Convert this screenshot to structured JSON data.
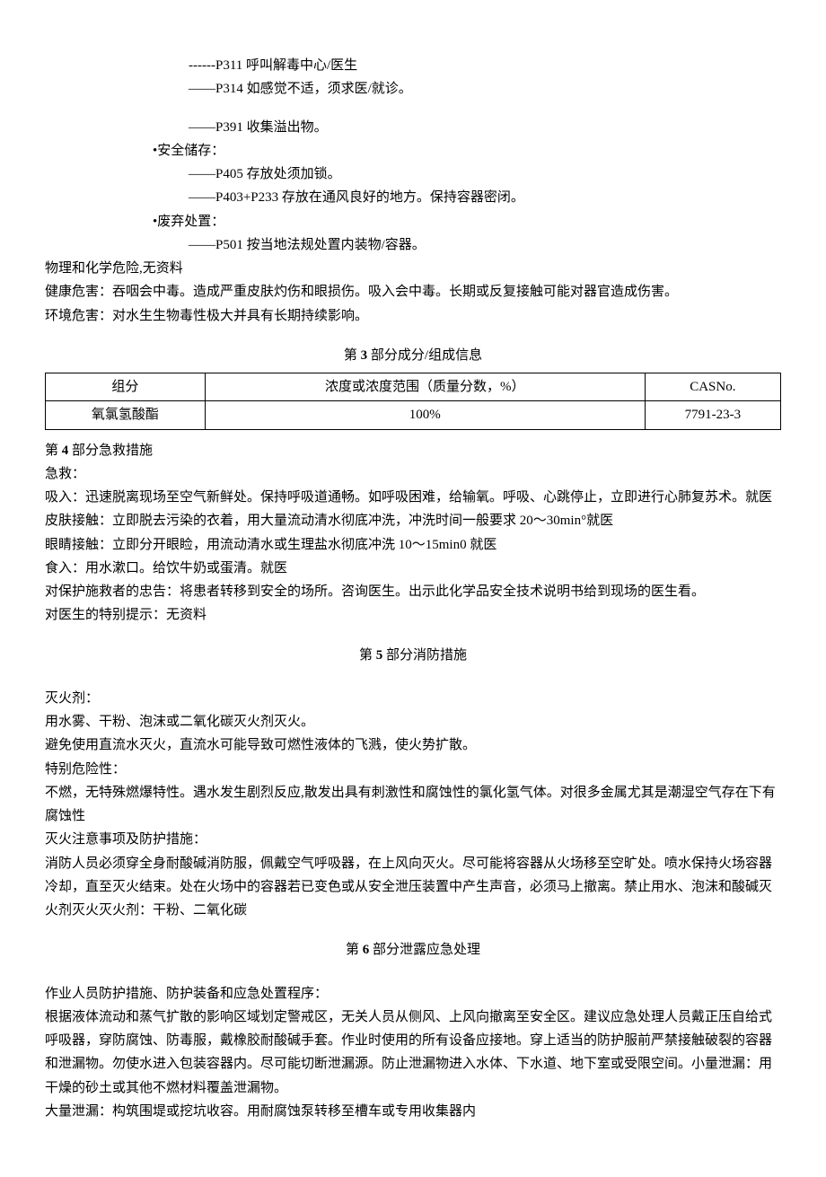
{
  "precautions": {
    "p311": "------P311 呼叫解毒中心/医生",
    "p314": "——P314 如感觉不适，须求医/就诊。",
    "p391": "——P391 收集溢出物。",
    "storage_header": "•安全储存：",
    "p405": "——P405 存放处须加锁。",
    "p403_233": "——P403+P233 存放在通风良好的地方。保持容器密闭。",
    "disposal_header": "•废弃处置：",
    "p501": "——P501 按当地法规处置内装物/容器。"
  },
  "hazards": {
    "phys_chem": "物理和化学危险,无资料",
    "health": "健康危害：吞咽会中毒。造成严重皮肤灼伤和眼损伤。吸入会中毒。长期或反复接触可能对器官造成伤害。",
    "env": "环境危害：对水生生物毒性极大并具有长期持续影响。"
  },
  "section3": {
    "title_prefix": "第 ",
    "title_num": "3",
    "title_suffix": " 部分成分/组成信息",
    "headers": {
      "c1": "组分",
      "c2": "浓度或浓度范围（质量分数，%）",
      "c3": "CASNo."
    },
    "row": {
      "c1": "氧氯氢酸酯",
      "c2": "100%",
      "c3": "7791-23-3"
    }
  },
  "section4": {
    "title_prefix": "第 ",
    "title_num": "4",
    "title_suffix": " 部分急救措施",
    "aid_label": "急救：",
    "inhalation": "吸入：迅速脱离现场至空气新鲜处。保持呼吸道通畅。如呼吸困难，给输氧。呼吸、心跳停止，立即进行心肺复苏术。就医",
    "skin": "皮肤接触：立即脱去污染的衣着，用大量流动清水彻底冲洗，冲洗时间一般要求 20～30min°就医",
    "eye": "眼睛接触：立即分开眼睑，用流动清水或生理盐水彻底冲洗 10～15min0 就医",
    "ingestion": "食入：用水漱口。给饮牛奶或蛋清。就医",
    "rescuer": "对保护施救者的忠告：将患者转移到安全的场所。咨询医生。出示此化学品安全技术说明书给到现场的医生看。",
    "doctor": "对医生的特别提示：无资料"
  },
  "section5": {
    "title_prefix": "第 ",
    "title_num": "5",
    "title_suffix": " 部分消防措施",
    "ext_label": "灭火剂：",
    "ext_use": "用水雾、干粉、泡沫或二氧化碳灭火剂灭火。",
    "ext_avoid": "避免使用直流水灭火，直流水可能导致可燃性液体的飞溅，使火势扩散。",
    "special_label": "特别危险性：",
    "special": "不燃，无特殊燃爆特性。遇水发生剧烈反应,散发出具有刺激性和腐蚀性的氯化氢气体。对很多金属尤其是潮湿空气存在下有腐蚀性",
    "notes_label": "灭火注意事项及防护措施：",
    "notes": "消防人员必须穿全身耐酸碱消防服，佩戴空气呼吸器，在上风向灭火。尽可能将容器从火场移至空旷处。喷水保持火场容器冷却，直至灭火结束。处在火场中的容器若已变色或从安全泄压装置中产生声音，必须马上撤离。禁止用水、泡沫和酸碱灭火剂灭火灭火剂：干粉、二氧化碳"
  },
  "section6": {
    "title_prefix": "第 ",
    "title_num": "6",
    "title_suffix": " 部分泄露应急处理",
    "proc_label": "作业人员防护措施、防护装备和应急处置程序：",
    "proc": "根据液体流动和蒸气扩散的影响区域划定警戒区，无关人员从侧风、上风向撤离至安全区。建议应急处理人员戴正压自给式呼吸器，穿防腐蚀、防毒服，戴橡胶耐酸碱手套。作业时使用的所有设备应接地。穿上适当的防护服前严禁接触破裂的容器和泄漏物。勿使水进入包装容器内。尽可能切断泄漏源。防止泄漏物进入水体、下水道、地下室或受限空间。小量泄漏：用干燥的砂土或其他不燃材料覆盖泄漏物。",
    "large": "大量泄漏：构筑围堤或挖坑收容。用耐腐蚀泵转移至槽车或专用收集器内"
  }
}
